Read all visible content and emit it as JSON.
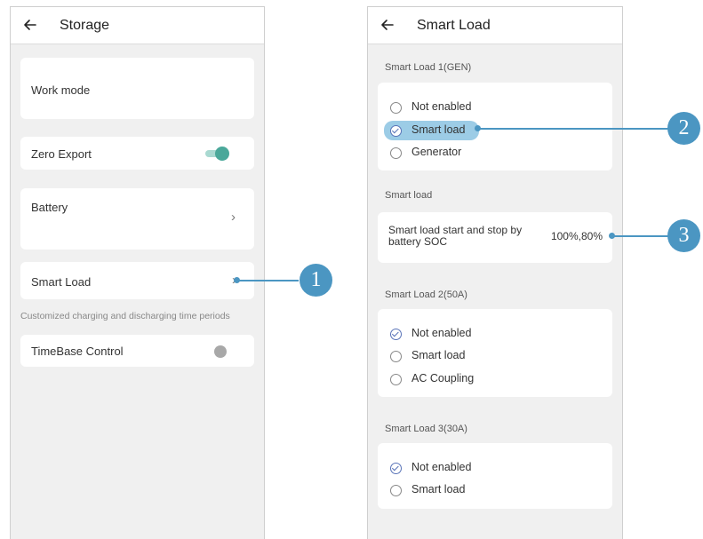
{
  "left_screen": {
    "title": "Storage",
    "work_mode_label": "Work mode",
    "zero_export_label": "Zero Export",
    "zero_export_enabled": true,
    "battery_label": "Battery",
    "smart_load_label": "Smart Load",
    "note": "Customized charging and discharging time periods",
    "timebase_label": "TimeBase Control",
    "timebase_enabled": false
  },
  "right_screen": {
    "title": "Smart Load",
    "load1": {
      "heading": "Smart Load 1(GEN)",
      "options": [
        "Not enabled",
        "Smart load",
        "Generator"
      ],
      "selected": "Smart load"
    },
    "smart_load_section": {
      "heading": "Smart load",
      "soc_label": "Smart load start and stop by battery SOC",
      "soc_value": "100%,80%"
    },
    "load2": {
      "heading": "Smart Load 2(50A)",
      "options": [
        "Not enabled",
        "Smart load",
        "AC Coupling"
      ],
      "selected": "Not enabled"
    },
    "load3": {
      "heading": "Smart Load 3(30A)",
      "options": [
        "Not enabled",
        "Smart load"
      ],
      "selected": "Not enabled"
    }
  },
  "callouts": [
    "1",
    "2",
    "3"
  ],
  "colors": {
    "accent_toggle": "#4aa89a",
    "callout": "#4b96c2",
    "radio_checked": "#5a74b8",
    "highlight": "#9ccce6"
  },
  "icons": [
    "back-arrow-icon",
    "chevron-right-icon"
  ]
}
